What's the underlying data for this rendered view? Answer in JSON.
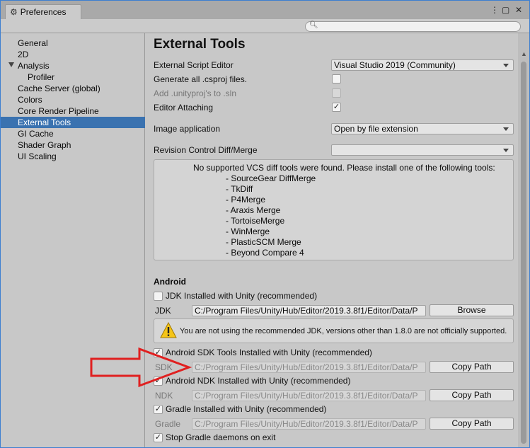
{
  "window": {
    "tab_title": "Preferences",
    "menu_icon": "kebab-menu-icon",
    "maximize_icon": "maximize-icon",
    "close_icon": "close-icon"
  },
  "search": {
    "placeholder": "",
    "icon": "search-icon"
  },
  "sidebar": {
    "items": [
      {
        "label": "General"
      },
      {
        "label": "2D"
      },
      {
        "label": "Analysis"
      },
      {
        "label": "Profiler"
      },
      {
        "label": "Cache Server (global)"
      },
      {
        "label": "Colors"
      },
      {
        "label": "Core Render Pipeline"
      },
      {
        "label": "External Tools"
      },
      {
        "label": "GI Cache"
      },
      {
        "label": "Shader Graph"
      },
      {
        "label": "UI Scaling"
      }
    ],
    "selected": "External Tools"
  },
  "main": {
    "title": "External Tools",
    "external_script_editor": {
      "label": "External Script Editor",
      "value": "Visual Studio 2019 (Community)"
    },
    "generate_csproj": {
      "label": "Generate all .csproj files.",
      "checked": false
    },
    "add_unityproj": {
      "label": "Add .unityproj's to .sln",
      "checked": false
    },
    "editor_attaching": {
      "label": "Editor Attaching",
      "checked": true,
      "check": "✓"
    },
    "image_application": {
      "label": "Image application",
      "value": "Open by file extension"
    },
    "revision_control": {
      "label": "Revision Control Diff/Merge",
      "value": ""
    },
    "vcs_message": "No supported VCS diff tools were found. Please install one of the following tools:",
    "vcs_tools": [
      "- SourceGear DiffMerge",
      "- TkDiff",
      "- P4Merge",
      "- Araxis Merge",
      "- TortoiseMerge",
      "- WinMerge",
      "- PlasticSCM Merge",
      "- Beyond Compare 4"
    ],
    "android": {
      "section_title": "Android",
      "jdk_installed": {
        "label": "JDK Installed with Unity (recommended)",
        "checked": false
      },
      "jdk": {
        "label": "JDK",
        "path": "C:/Program Files/Unity/Hub/Editor/2019.3.8f1/Editor/Data/P",
        "button": "Browse"
      },
      "jdk_warning": "You are not using the recommended JDK, versions other than 1.8.0 are not officially supported.",
      "sdk_installed": {
        "label": "Android SDK Tools Installed with Unity (recommended)",
        "checked": true,
        "check": "✓"
      },
      "sdk": {
        "label": "SDK",
        "path": "C:/Program Files/Unity/Hub/Editor/2019.3.8f1/Editor/Data/P",
        "button": "Copy Path"
      },
      "ndk_installed": {
        "label": "Android NDK Installed with Unity (recommended)",
        "checked": true,
        "check": "✓"
      },
      "ndk": {
        "label": "NDK",
        "path": "C:/Program Files/Unity/Hub/Editor/2019.3.8f1/Editor/Data/P",
        "button": "Copy Path"
      },
      "gradle_installed": {
        "label": "Gradle Installed with Unity (recommended)",
        "checked": true,
        "check": "✓"
      },
      "gradle": {
        "label": "Gradle",
        "path": "C:/Program Files/Unity/Hub/Editor/2019.3.8f1/Editor/Data/P",
        "button": "Copy Path"
      },
      "stop_gradle": {
        "label": "Stop Gradle daemons on exit",
        "checked": true,
        "check": "✓"
      }
    }
  },
  "annotation": {
    "arrow_color": "#e02020"
  },
  "colors": {
    "selection": "#3a72b0",
    "window_border": "#3d7fd0"
  }
}
